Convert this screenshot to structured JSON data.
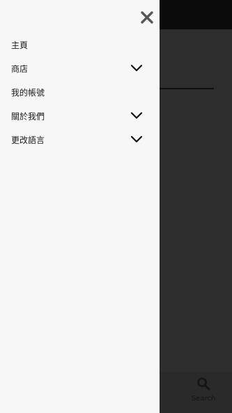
{
  "drawer": {
    "close_icon": "close-icon",
    "items": [
      {
        "label": "主頁",
        "expandable": false
      },
      {
        "label": "商店",
        "expandable": true
      },
      {
        "label": "我的帳號",
        "expandable": false
      },
      {
        "label": "關於我們",
        "expandable": true
      },
      {
        "label": "更改語言",
        "expandable": true
      }
    ]
  },
  "bottom_nav": {
    "search_label": "Search",
    "search_icon": "search-icon"
  },
  "colors": {
    "drawer_bg": "#f7f7f7",
    "overlay": "#2d2d2d",
    "text": "#1a1a1a"
  }
}
